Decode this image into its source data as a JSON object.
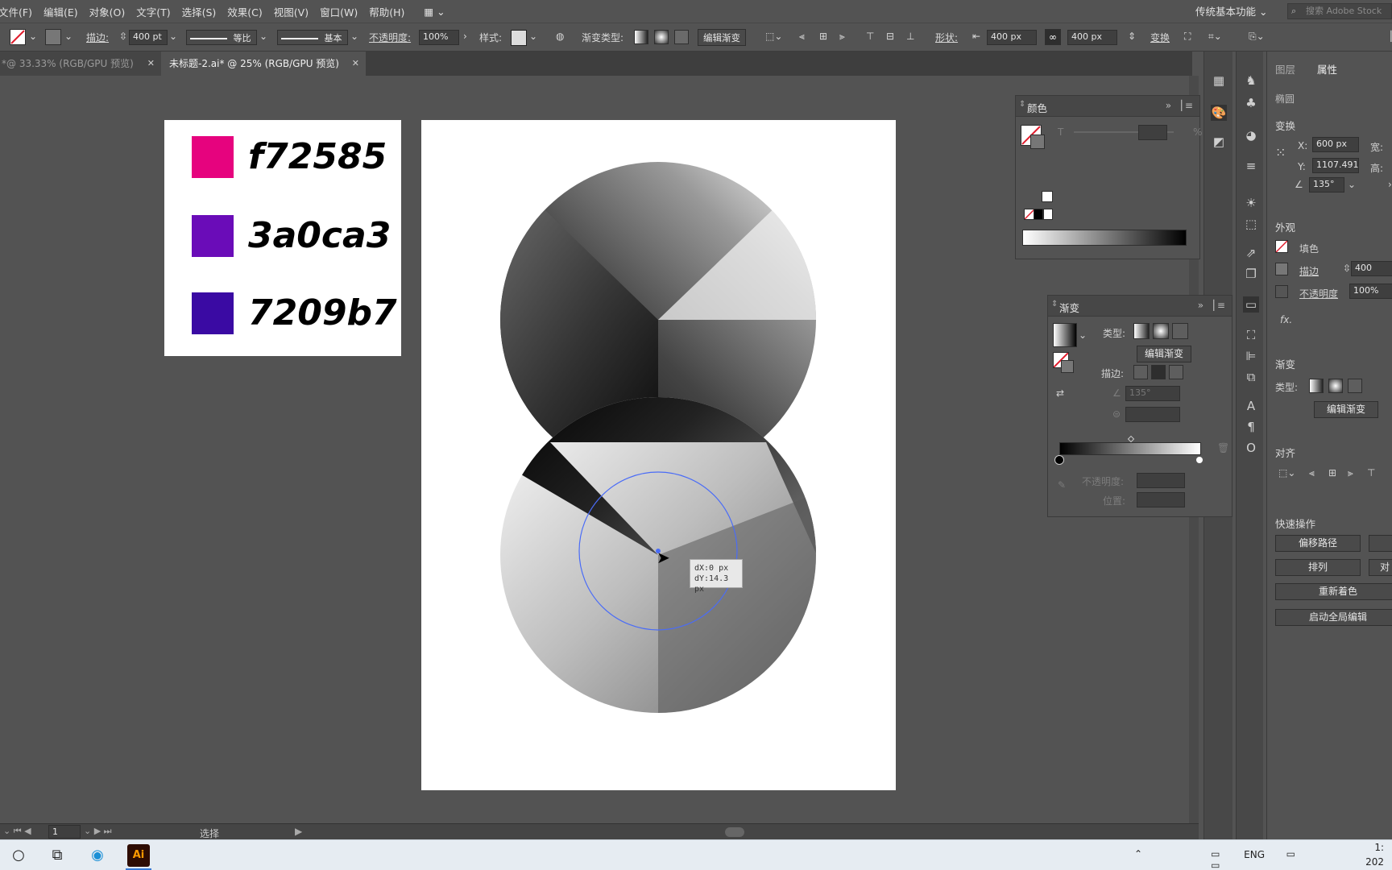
{
  "menu": [
    "文件(F)",
    "编辑(E)",
    "对象(O)",
    "文字(T)",
    "选择(S)",
    "效果(C)",
    "视图(V)",
    "窗口(W)",
    "帮助(H)"
  ],
  "workspace": "传统基本功能",
  "stock_search_placeholder": "搜索 Adobe Stock",
  "control": {
    "stroke_label": "描边:",
    "stroke_value": "400 pt",
    "profile_label": "等比",
    "brush_label": "基本",
    "opacity_label": "不透明度:",
    "opacity_value": "100%",
    "style_label": "样式:",
    "gradient_type_label": "渐变类型:",
    "edit_gradient": "编辑渐变",
    "shape_label": "形状:",
    "width_value": "400 px",
    "height_value": "400 px",
    "transform": "变换"
  },
  "tabs": [
    {
      "label": "*@ 33.33% (RGB/GPU 预览)",
      "active": false
    },
    {
      "label": "未标题-2.ai* @ 25% (RGB/GPU 预览)",
      "active": true
    }
  ],
  "swatches": [
    {
      "label": "f72585",
      "color": "#e6037e"
    },
    {
      "label": "3a0ca3",
      "color": "#6a0cb8"
    },
    {
      "label": "7209b7",
      "color": "#3a0aa3"
    }
  ],
  "tooltip": {
    "dx": "dX:0 px",
    "dy": "dY:14.3 px"
  },
  "color_panel": {
    "title": "颜色",
    "t_label": "T",
    "percent": "%"
  },
  "gradient_panel": {
    "title": "渐变",
    "type_label": "类型:",
    "edit_gradient": "编辑渐变",
    "stroke_label": "描边:",
    "angle_value": "135°",
    "opacity_label": "不透明度:",
    "position_label": "位置:"
  },
  "properties": {
    "tab_layers": "图层",
    "tab_properties": "属性",
    "object_type": "椭圆",
    "transform_title": "变换",
    "x_label": "X:",
    "x_value": "600 px",
    "y_label": "Y:",
    "y_value": "1107.491",
    "w_label": "宽:",
    "h_label": "高:",
    "angle_value": "135°",
    "appearance_title": "外观",
    "fill_label": "填色",
    "stroke_label": "描边",
    "stroke_value": "400",
    "opacity_label": "不透明度",
    "opacity_value": "100%",
    "fx_label": "fx.",
    "gradient_title": "渐变",
    "type_label": "类型:",
    "edit_gradient": "编辑渐变",
    "align_title": "对齐",
    "quick_actions_title": "快速操作",
    "offset_path": "偏移路径",
    "arrange": "排列",
    "arrange_partial": "对",
    "recolor": "重新着色",
    "global_edit": "启动全局编辑"
  },
  "status": {
    "page": "1",
    "tool": "选择"
  },
  "taskbar": {
    "lang": "ENG",
    "time": "1:",
    "date": "202"
  }
}
